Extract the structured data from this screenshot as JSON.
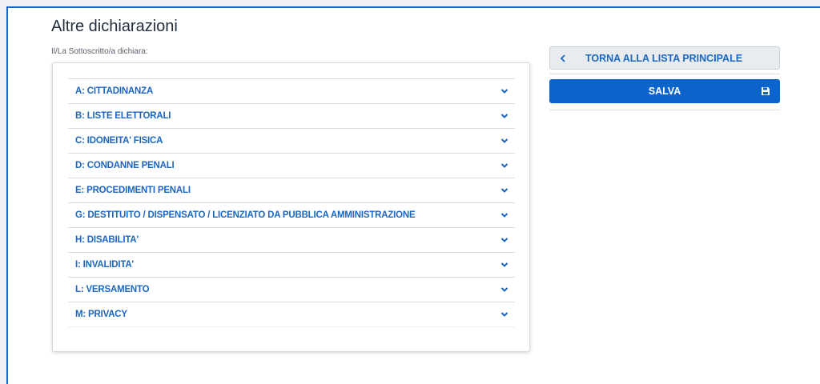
{
  "page": {
    "title": "Altre dichiarazioni",
    "subtitle": "Il/La Sottoscritto/a dichiara:"
  },
  "accordion": {
    "items": [
      {
        "label": "A: CITTADINANZA"
      },
      {
        "label": "B: LISTE ELETTORALI"
      },
      {
        "label": "C: IDONEITA' FISICA"
      },
      {
        "label": "D: CONDANNE PENALI"
      },
      {
        "label": "E: PROCEDIMENTI PENALI"
      },
      {
        "label": "G: DESTITUITO / DISPENSATO / LICENZIATO DA PUBBLICA AMMINISTRAZIONE"
      },
      {
        "label": "H: DISABILITA'"
      },
      {
        "label": "I: INVALIDITA'"
      },
      {
        "label": "L: VERSAMENTO"
      },
      {
        "label": "M: PRIVACY"
      }
    ],
    "icon": "chevron-down-icon"
  },
  "actions": {
    "back_label": "TORNA ALLA LISTA PRINCIPALE",
    "back_icon": "chevron-left-icon",
    "save_label": "SALVA",
    "save_icon": "floppy-disk-icon"
  },
  "colors": {
    "accent": "#1a66c2",
    "primary_button": "#0b63cc",
    "title_text": "#1f2d3d"
  }
}
